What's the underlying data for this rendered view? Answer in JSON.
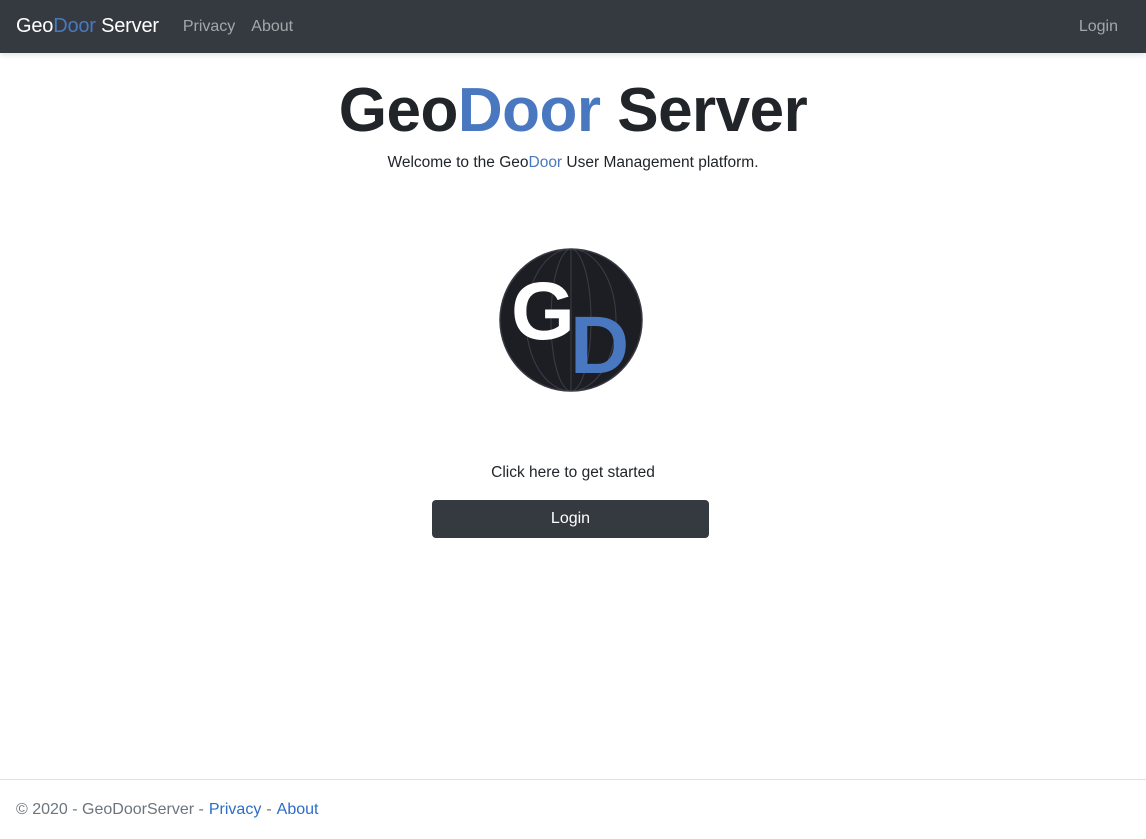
{
  "navbar": {
    "brand": {
      "part1": "Geo",
      "part2": "Door",
      "part3": " Server"
    },
    "links": [
      "Privacy",
      "About"
    ],
    "login": "Login"
  },
  "hero": {
    "title": {
      "part1": "Geo",
      "part2": "Door",
      "part3": " Server"
    },
    "subtitle": {
      "prefix": "Welcome to the ",
      "geo": "Geo",
      "door": "Door",
      "suffix": " User Management platform."
    },
    "logo": {
      "letter1": "G",
      "letter2": "D"
    },
    "cta_text": "Click here to get started",
    "login_button": "Login"
  },
  "footer": {
    "copyright": "© 2020 - GeoDoorServer -",
    "privacy": "Privacy",
    "separator": "-",
    "about": "About"
  },
  "colors": {
    "navbar_bg": "#343a40",
    "accent_blue": "#4a78c0",
    "link_blue": "#2b6dc9",
    "logo_bg": "#1d1d24"
  }
}
